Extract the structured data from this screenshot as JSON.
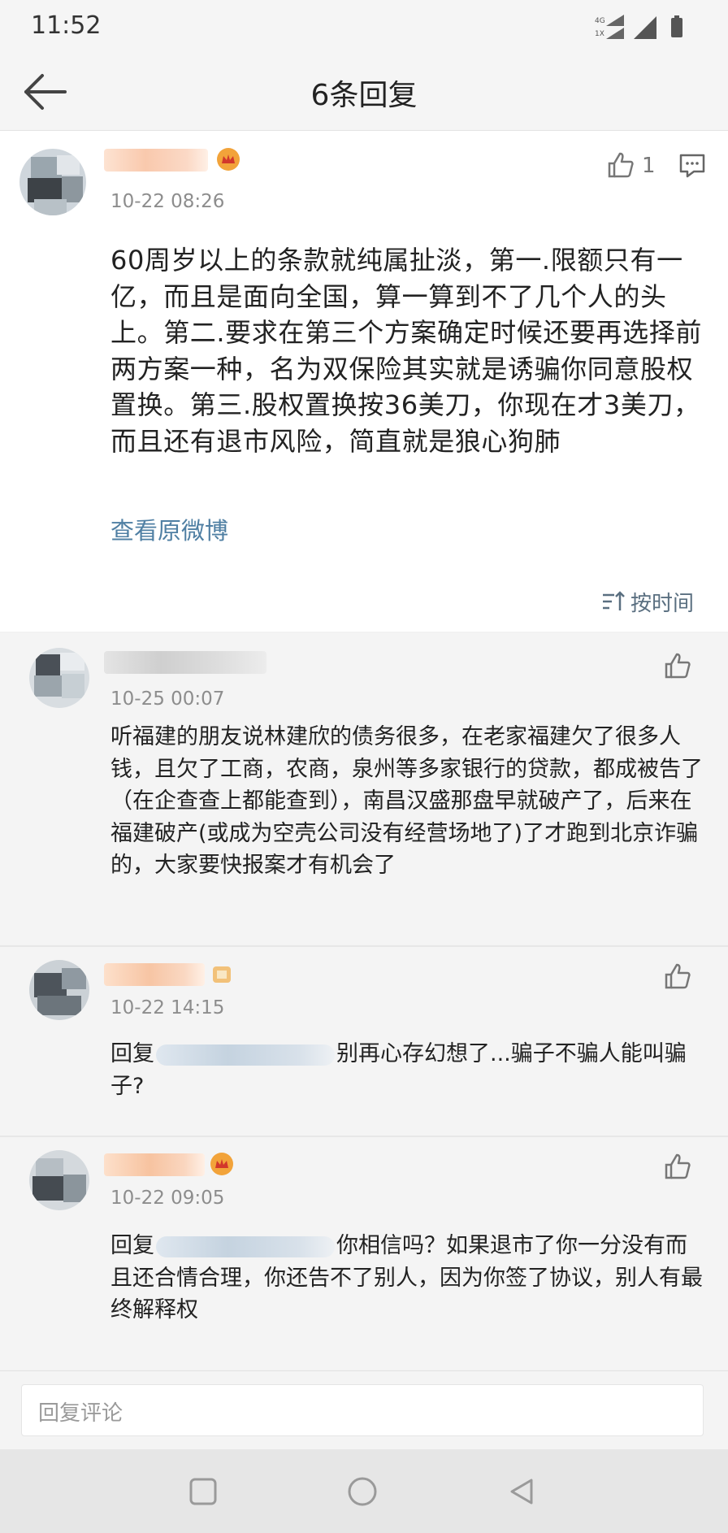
{
  "status_bar": {
    "time": "11:52",
    "network_top": "4G",
    "network_bottom": "1X"
  },
  "header": {
    "title": "6条回复",
    "back_icon": "arrow-left-icon"
  },
  "main_comment": {
    "time": "10-22 08:26",
    "like_count": "1",
    "text": "60周岁以上的条款就纯属扯淡，第一.限额只有一亿，而且是面向全国，算一算到不了几个人的头上。第二.要求在第三个方案确定时候还要再选择前两方案一种，名为双保险其实就是诱骗你同意股权置换。第三.股权置换按36美刀，你现在才3美刀，而且还有退市风险，简直就是狼心狗肺",
    "view_original": "查看原微博",
    "sort_label": "按时间"
  },
  "replies": [
    {
      "time": "10-25 00:07",
      "text": "听福建的朋友说林建欣的债务很多，在老家福建欠了很多人钱，且欠了工商，农商，泉州等多家银行的贷款，都成被告了（在企查查上都能查到），南昌汉盛那盘早就破产了，后来在福建破产(或成为空壳公司没有经营场地了)了才跑到北京诈骗的，大家要快报案才有机会了"
    },
    {
      "time": "10-22 14:15",
      "prefix": "回复",
      "text": "别再心存幻想了...骗子不骗人能叫骗子?"
    },
    {
      "time": "10-22 09:05",
      "prefix": "回复",
      "text": "你相信吗？如果退市了你一分没有而且还合情合理，你还告不了别人，因为你签了协议，别人有最终解释权"
    }
  ],
  "reply_input": {
    "placeholder": "回复评论"
  },
  "colors": {
    "link": "#4f7fa3",
    "badge": "#f2a33a",
    "background": "#f2f2f2"
  }
}
